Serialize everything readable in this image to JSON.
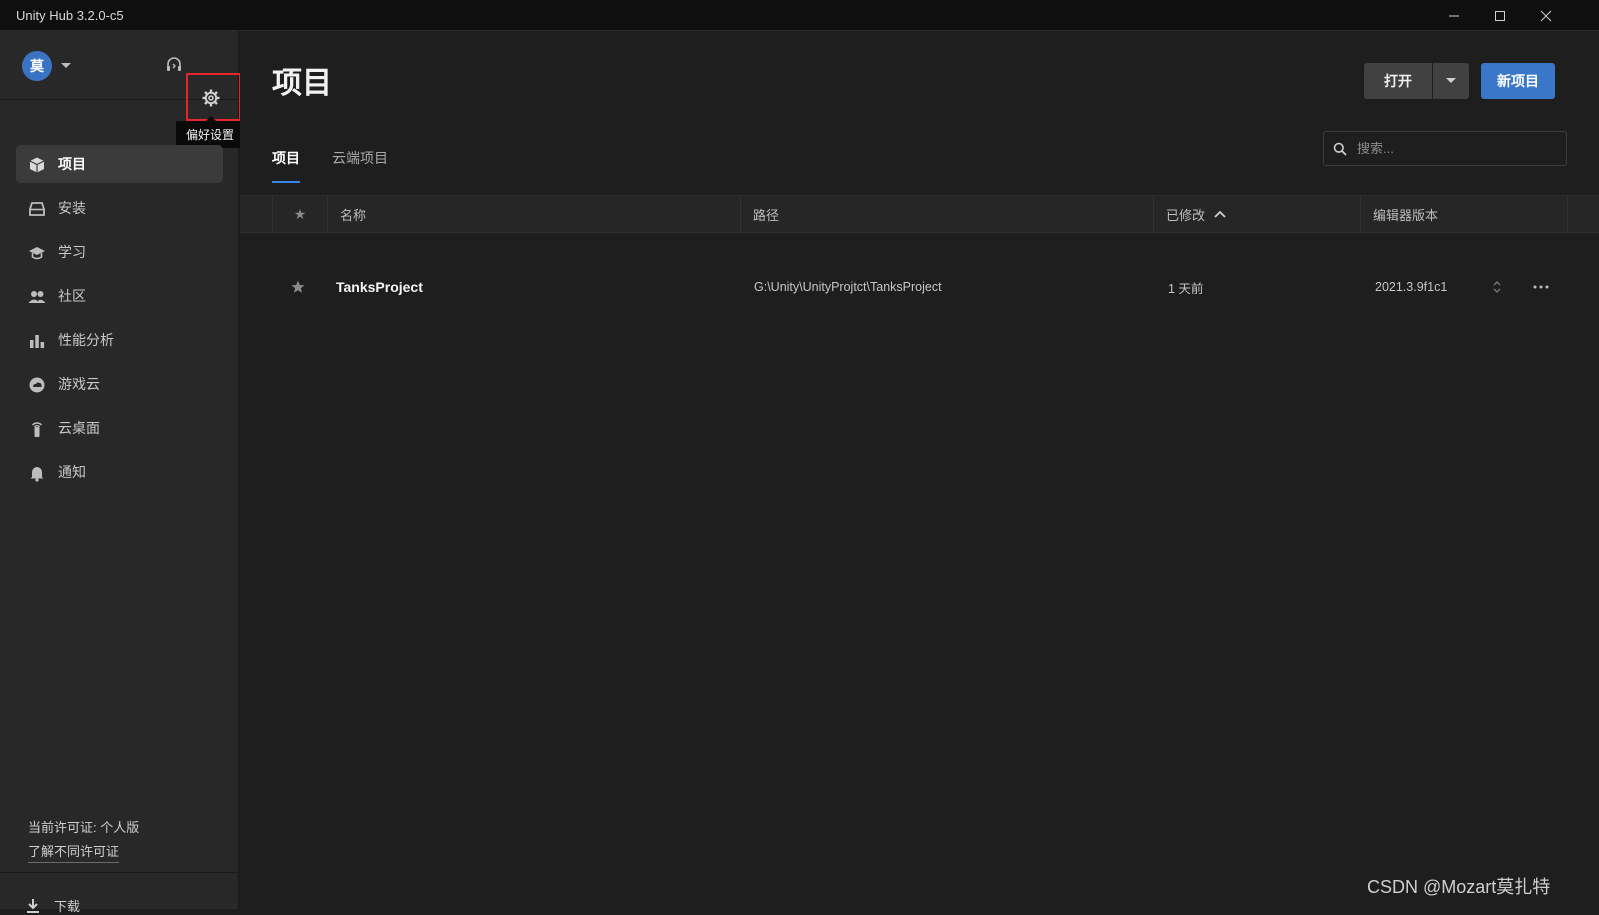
{
  "window": {
    "title": "Unity Hub 3.2.0-c5",
    "controls": [
      "minimize",
      "maximize",
      "close"
    ]
  },
  "sidebar": {
    "avatar_initial": "莫",
    "tooltip": "偏好设置",
    "items": [
      {
        "label": "项目",
        "icon": "cube-icon",
        "active": true
      },
      {
        "label": "安装",
        "icon": "install-drive-icon",
        "active": false
      },
      {
        "label": "学习",
        "icon": "graduation-cap-icon",
        "active": false
      },
      {
        "label": "社区",
        "icon": "people-icon",
        "active": false
      },
      {
        "label": "性能分析",
        "icon": "bar-chart-icon",
        "active": false
      },
      {
        "label": "游戏云",
        "icon": "cloud-icon",
        "active": false
      },
      {
        "label": "云桌面",
        "icon": "antenna-icon",
        "active": false
      },
      {
        "label": "通知",
        "icon": "bell-icon",
        "active": false
      }
    ],
    "license_current": "当前许可证: 个人版",
    "license_link": "了解不同许可证",
    "download_label": "下载"
  },
  "main": {
    "title": "项目",
    "open_button": "打开",
    "new_button": "新项目",
    "tabs": [
      {
        "label": "项目",
        "active": true
      },
      {
        "label": "云端项目",
        "active": false
      }
    ],
    "search_placeholder": "搜索..."
  },
  "table": {
    "headers": {
      "star": "★",
      "name": "名称",
      "path": "路径",
      "modified": "已修改",
      "version": "编辑器版本"
    },
    "rows": [
      {
        "starred": false,
        "name": "TanksProject",
        "path": "G:\\Unity\\UnityProjtct\\TanksProject",
        "modified": "1 天前",
        "version": "2021.3.9f1c1"
      }
    ]
  },
  "watermark": "CSDN @Mozart莫扎特",
  "colors": {
    "accent": "#3a77c8",
    "highlight_box": "#e5262b",
    "background": "#1e1e1e",
    "sidebar": "#282828"
  }
}
